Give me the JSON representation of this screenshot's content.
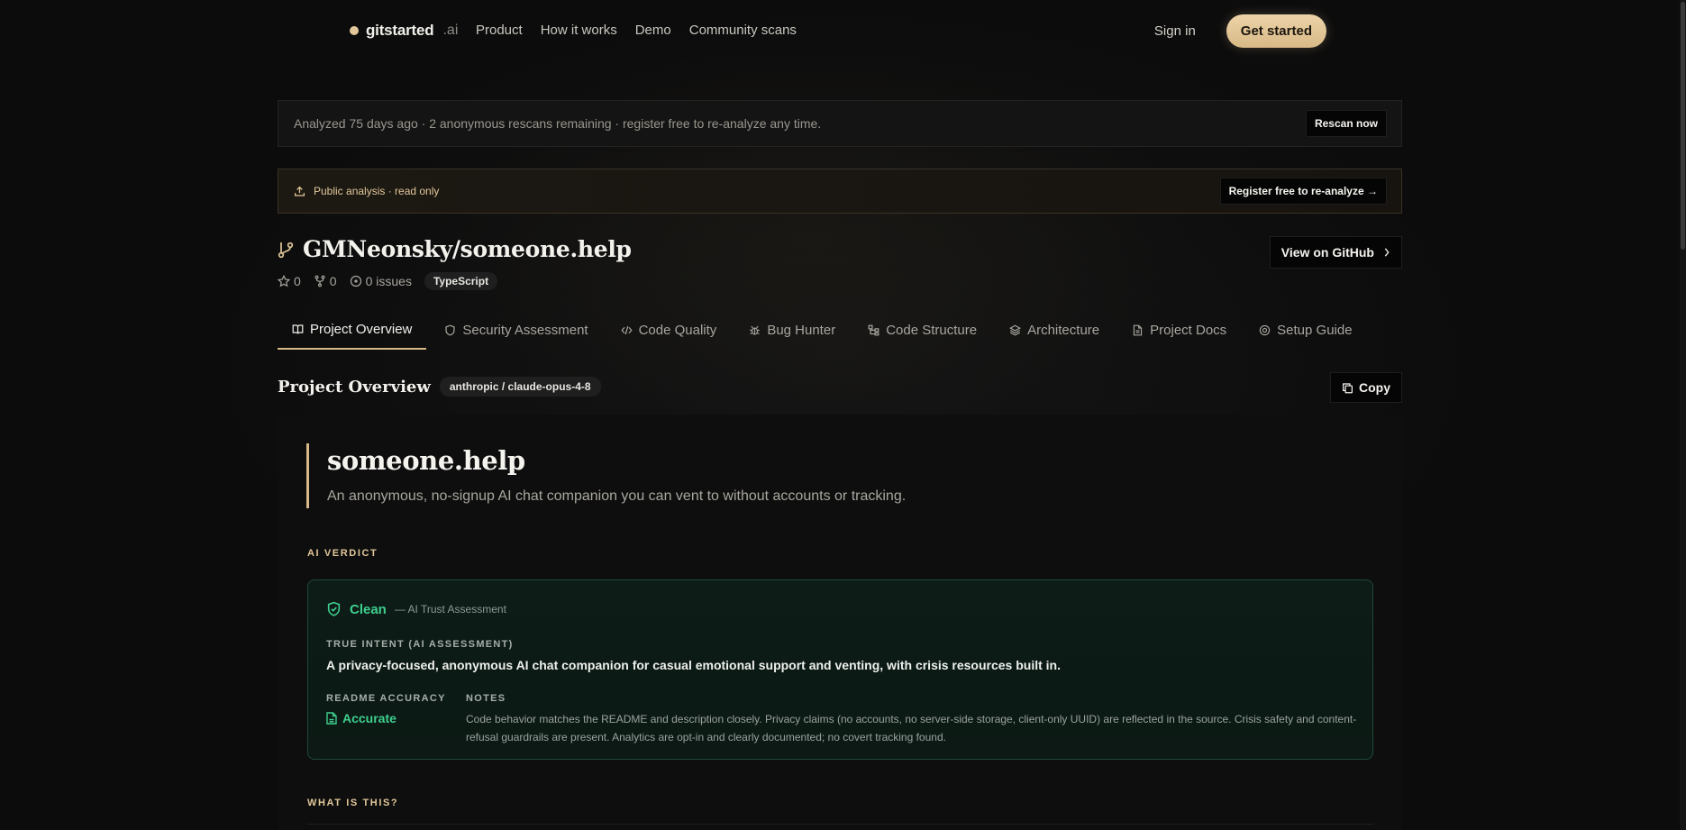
{
  "nav": {
    "brand_name": "gitstarted",
    "brand_tld": ".ai",
    "links": [
      "Product",
      "How it works",
      "Demo",
      "Community scans"
    ],
    "signin": "Sign in",
    "get_started": "Get started"
  },
  "banner_rescan": {
    "text": "Analyzed 75 days ago · 2 anonymous rescans remaining · register free to re-analyze any time.",
    "button": "Rescan now"
  },
  "banner_public": {
    "text": "Public analysis · read only",
    "button": "Register free to re-analyze →"
  },
  "repo": {
    "name": "GMNeonsky/someone.help",
    "stars": "0",
    "forks": "0",
    "issues": "0 issues",
    "language": "TypeScript",
    "view_github": "View on GitHub"
  },
  "tabs": [
    {
      "label": "Project Overview",
      "icon": "book-icon",
      "active": true
    },
    {
      "label": "Security Assessment",
      "icon": "shield-icon",
      "active": false
    },
    {
      "label": "Code Quality",
      "icon": "code-icon",
      "active": false
    },
    {
      "label": "Bug Hunter",
      "icon": "bug-icon",
      "active": false
    },
    {
      "label": "Code Structure",
      "icon": "structure-icon",
      "active": false
    },
    {
      "label": "Architecture",
      "icon": "layers-icon",
      "active": false
    },
    {
      "label": "Project Docs",
      "icon": "doc-icon",
      "active": false
    },
    {
      "label": "Setup Guide",
      "icon": "target-icon",
      "active": false
    }
  ],
  "section": {
    "title": "Project Overview",
    "model": "anthropic / claude-opus-4-8",
    "copy": "Copy"
  },
  "overview": {
    "title": "someone.help",
    "tagline": "An anonymous, no-signup AI chat companion you can vent to without accounts or tracking.",
    "verdict_label": "AI VERDICT",
    "what_label": "WHAT IS THIS?"
  },
  "verdict": {
    "status": "Clean",
    "subtitle": "— AI Trust Assessment",
    "intent_label": "TRUE INTENT (AI ASSESSMENT)",
    "intent": "A privacy-focused, anonymous AI chat companion for casual emotional support and venting, with crisis resources built in.",
    "readme_label": "README ACCURACY",
    "readme_value": "Accurate",
    "notes_label": "NOTES",
    "notes": "Code behavior matches the README and description closely. Privacy claims (no accounts, no server-side storage, client-only UUID) are reflected in the source. Crisis safety and content-refusal guardrails are present. Analytics are opt-in and clearly documented; no covert tracking found."
  },
  "colors": {
    "accent": "#e2c89a",
    "success": "#3ecf8e",
    "background": "#0c0c0c"
  }
}
